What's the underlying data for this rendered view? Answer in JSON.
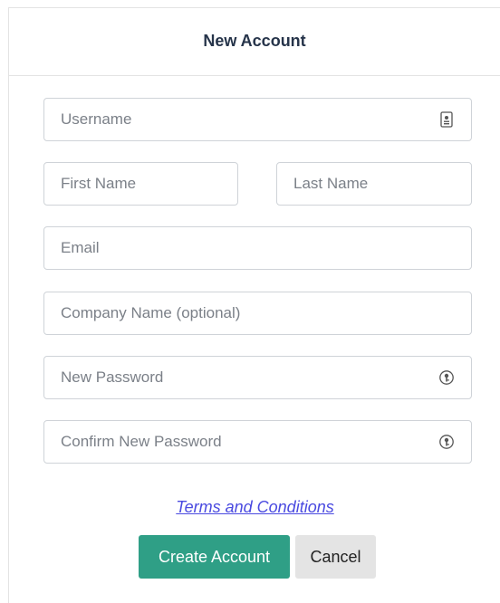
{
  "header": {
    "title": "New Account"
  },
  "form": {
    "username_placeholder": "Username",
    "first_name_placeholder": "First Name",
    "last_name_placeholder": "Last Name",
    "email_placeholder": "Email",
    "company_placeholder": "Company Name (optional)",
    "new_password_placeholder": "New Password",
    "confirm_password_placeholder": "Confirm New Password"
  },
  "icons": {
    "username": "contact-card-icon",
    "new_password": "password-key-icon",
    "confirm_password": "password-key-icon"
  },
  "links": {
    "terms": "Terms and Conditions"
  },
  "actions": {
    "create_label": "Create Account",
    "cancel_label": "Cancel"
  },
  "colors": {
    "primary": "#2f9f86",
    "link": "#4a4ae0",
    "title": "#26344a"
  }
}
